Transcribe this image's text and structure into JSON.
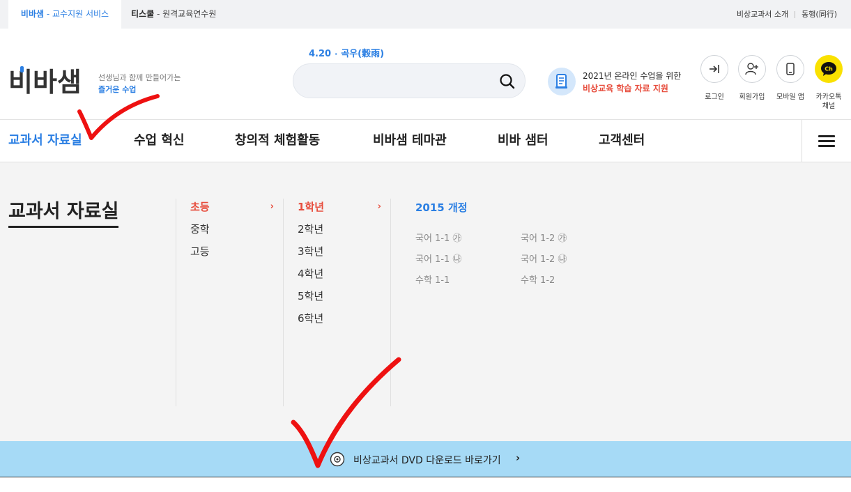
{
  "topbar": {
    "tab1_brand": "비바샘",
    "tab1_desc": " - 교수지원 서비스",
    "tab2_brand": "티스쿨",
    "tab2_desc": " - 원격교육연수원",
    "link_about": "비상교과서 소개",
    "link_together": "동행(同行)"
  },
  "header": {
    "logo_prefix": "ㅂ",
    "logo_text": "비바샘",
    "slogan_line1": "선생님과 함께 만들어가는",
    "slogan_line2": "즐거운 수업",
    "tagline_date": "4.20",
    "tagline_term": "곡우(穀雨)",
    "search_placeholder": "",
    "notice_line1": "2021년 온라인 수업을 위한",
    "notice_line2": "비상교육 학습 자료 지원",
    "utils": {
      "login": "로그인",
      "signup": "회원가입",
      "mobile": "모바일 앱",
      "kakao_line1": "카카오톡",
      "kakao_line2": "채널",
      "kakao_badge": "Ch"
    }
  },
  "gnb": {
    "items": [
      "교과서 자료실",
      "수업 혁신",
      "창의적 체험활동",
      "비바샘 테마관",
      "비바 샘터",
      "고객센터"
    ]
  },
  "panel": {
    "title": "교과서 자료실",
    "levels": [
      "초등",
      "중학",
      "고등"
    ],
    "grades": [
      "1학년",
      "2학년",
      "3학년",
      "4학년",
      "5학년",
      "6학년"
    ],
    "arrow": "›",
    "revision": "2015 개정",
    "subjects": [
      "국어 1-1 ㉮",
      "국어 1-2 ㉮",
      "국어 1-1 ㉯",
      "국어 1-2 ㉯",
      "수학 1-1",
      "수학 1-2"
    ]
  },
  "dvd": {
    "label": "비상교과서 DVD 다운로드 바로가기",
    "chevron": "›"
  },
  "colors": {
    "accent": "#2b7fe3",
    "highlight": "#e74c3c",
    "banner": "#a6daf6",
    "kakao": "#fae100"
  }
}
